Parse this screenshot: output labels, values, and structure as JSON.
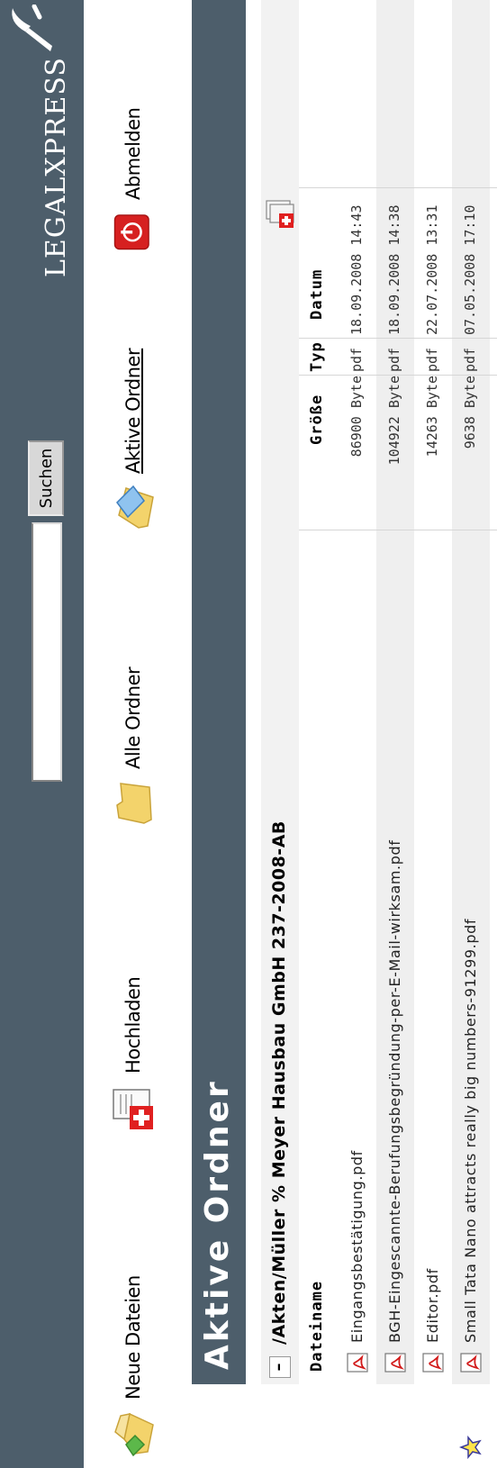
{
  "header": {
    "search": {
      "value": "",
      "button_label": "Suchen"
    },
    "logo": {
      "text": "LEGALXPRESS"
    }
  },
  "nav": {
    "new_files": "Neue Dateien",
    "upload": "Hochladen",
    "all_folders": "Alle Ordner",
    "active_folders": "Aktive Ordner",
    "logout": "Abmelden"
  },
  "page_title": "Aktive Ordner",
  "folder": {
    "collapse_symbol": "–",
    "path": "/Akten/Müller % Meyer Hausbau GmbH 237-2008-AB",
    "columns": {
      "name": "Dateiname",
      "size": "Größe",
      "type": "Typ",
      "date": "Datum"
    },
    "files": [
      {
        "name": "Eingangsbestätigung.pdf",
        "size": "86900 Byte",
        "type": "pdf",
        "date": "18.09.2008 14:43"
      },
      {
        "name": "BGH-Eingescannte-Berufungsbegründung-per-E-Mail-wirksam.pdf",
        "size": "104922 Byte",
        "type": "pdf",
        "date": "18.09.2008 14:38"
      },
      {
        "name": "Editor.pdf",
        "size": "14263 Byte",
        "type": "pdf",
        "date": "22.07.2008 13:31"
      },
      {
        "name": "Small Tata Nano attracts really big numbers-91299.pdf",
        "size": "9638 Byte",
        "type": "pdf",
        "date": "07.05.2008 17:10"
      }
    ]
  },
  "colors": {
    "header_bg": "#4d5e6b",
    "row_alt": "#efefef",
    "accent_red": "#e02020",
    "folder_yellow": "#f3d36b"
  }
}
